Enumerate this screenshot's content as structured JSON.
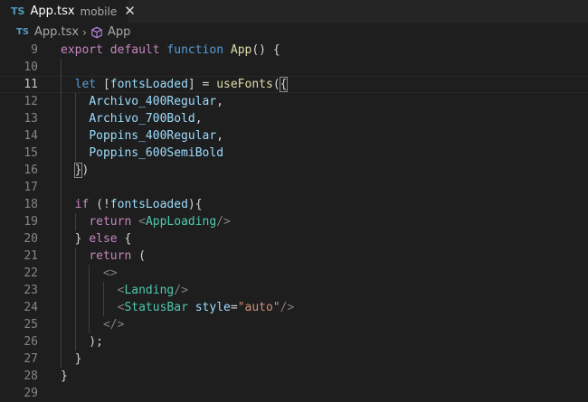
{
  "tab": {
    "type_badge": "TS",
    "file_name": "App.tsx",
    "description": "mobile",
    "close_glyph": "✕"
  },
  "breadcrumb": {
    "type_badge": "TS",
    "file": "App.tsx",
    "separator": "›",
    "symbol": "App",
    "symbol_icon": "cube-icon"
  },
  "editor": {
    "active_line": 11,
    "lines": [
      {
        "n": "9",
        "tokens": [
          [
            "c",
            "export"
          ],
          [
            "p",
            " "
          ],
          [
            "c",
            "default"
          ],
          [
            "p",
            " "
          ],
          [
            "k",
            "function"
          ],
          [
            "p",
            " "
          ],
          [
            "f",
            "App"
          ],
          [
            "p",
            "() {"
          ]
        ]
      },
      {
        "n": "10",
        "tokens": []
      },
      {
        "n": "11",
        "tokens": [
          [
            "p",
            "  "
          ],
          [
            "k",
            "let"
          ],
          [
            "p",
            " ["
          ],
          [
            "v",
            "fontsLoaded"
          ],
          [
            "p",
            "] = "
          ],
          [
            "f",
            "useFonts"
          ],
          [
            "p",
            "("
          ],
          [
            "pb",
            "{"
          ]
        ]
      },
      {
        "n": "12",
        "tokens": [
          [
            "p",
            "    "
          ],
          [
            "v",
            "Archivo_400Regular"
          ],
          [
            "p",
            ","
          ]
        ]
      },
      {
        "n": "13",
        "tokens": [
          [
            "p",
            "    "
          ],
          [
            "v",
            "Archivo_700Bold"
          ],
          [
            "p",
            ","
          ]
        ]
      },
      {
        "n": "14",
        "tokens": [
          [
            "p",
            "    "
          ],
          [
            "v",
            "Poppins_400Regular"
          ],
          [
            "p",
            ","
          ]
        ]
      },
      {
        "n": "15",
        "tokens": [
          [
            "p",
            "    "
          ],
          [
            "v",
            "Poppins_600SemiBold"
          ]
        ]
      },
      {
        "n": "16",
        "tokens": [
          [
            "p",
            "  "
          ],
          [
            "pb",
            "}"
          ],
          [
            "p",
            ")"
          ]
        ]
      },
      {
        "n": "17",
        "tokens": []
      },
      {
        "n": "18",
        "tokens": [
          [
            "p",
            "  "
          ],
          [
            "c",
            "if"
          ],
          [
            "p",
            " (!"
          ],
          [
            "v",
            "fontsLoaded"
          ],
          [
            "p",
            "){"
          ]
        ]
      },
      {
        "n": "19",
        "tokens": [
          [
            "p",
            "    "
          ],
          [
            "c",
            "return"
          ],
          [
            "p",
            " "
          ],
          [
            "g",
            "<"
          ],
          [
            "t",
            "AppLoading"
          ],
          [
            "g",
            "/>"
          ]
        ]
      },
      {
        "n": "20",
        "tokens": [
          [
            "p",
            "  } "
          ],
          [
            "c",
            "else"
          ],
          [
            "p",
            " {"
          ]
        ]
      },
      {
        "n": "21",
        "tokens": [
          [
            "p",
            "    "
          ],
          [
            "c",
            "return"
          ],
          [
            "p",
            " ("
          ]
        ]
      },
      {
        "n": "22",
        "tokens": [
          [
            "p",
            "      "
          ],
          [
            "g",
            "<>"
          ]
        ]
      },
      {
        "n": "23",
        "tokens": [
          [
            "p",
            "        "
          ],
          [
            "g",
            "<"
          ],
          [
            "t",
            "Landing"
          ],
          [
            "g",
            "/>"
          ]
        ]
      },
      {
        "n": "24",
        "tokens": [
          [
            "p",
            "        "
          ],
          [
            "g",
            "<"
          ],
          [
            "t",
            "StatusBar"
          ],
          [
            "p",
            " "
          ],
          [
            "v",
            "style"
          ],
          [
            "p",
            "="
          ],
          [
            "s",
            "\"auto\""
          ],
          [
            "g",
            "/>"
          ]
        ]
      },
      {
        "n": "25",
        "tokens": [
          [
            "p",
            "      "
          ],
          [
            "g",
            "</>"
          ]
        ]
      },
      {
        "n": "26",
        "tokens": [
          [
            "p",
            "    );"
          ]
        ]
      },
      {
        "n": "27",
        "tokens": [
          [
            "p",
            "  }"
          ]
        ]
      },
      {
        "n": "28",
        "tokens": [
          [
            "p",
            "}"
          ]
        ]
      },
      {
        "n": "29",
        "tokens": []
      }
    ]
  }
}
